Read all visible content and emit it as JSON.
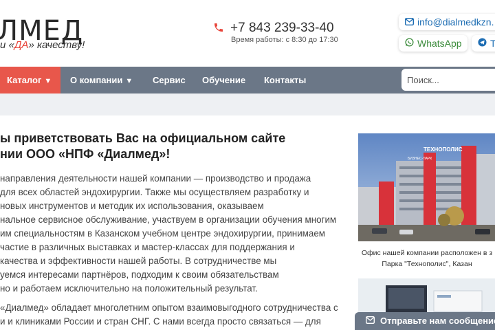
{
  "header": {
    "logo_main": "ЛМЕД",
    "logo_tag_pre": "и «",
    "logo_tag_da": "ДА",
    "logo_tag_post": "» качеству!",
    "phone": "+7 843 239-33-40",
    "work_hours": "Время работы: с 8:30 до 17:30",
    "email": "info@dialmedkzn.",
    "whatsapp": "WhatsApp",
    "telegram": "Т"
  },
  "nav": {
    "catalog": "Каталог",
    "items": [
      "О компании",
      "Сервис",
      "Обучение",
      "Контакты"
    ],
    "search_placeholder": "Поиск..."
  },
  "content": {
    "title_lines": [
      "ы приветствовать Вас на официальном сайте",
      "нии ООО «НПФ «Диалмед»!"
    ],
    "para1_lines": [
      "направления деятельности нашей компании — производство и продажа",
      "для всех областей эндохирургии. Также мы осуществляем разработку и",
      "новых инструментов и методик их использования, оказываем",
      "нальное сервисное обслуживание, участвуем в организации обучения многим",
      "им специальностям в Казанском учебном центре эндохирургии, принимаем",
      "частие в различных выставках и мастер-классах для поддержания и",
      "качества и эффективности нашей работы. В сотрудничестве мы",
      "уемся интересами партнёров, подходим к своим обязательствам",
      "но и работаем исключительно на положительный результат."
    ],
    "para2_lines": [
      "«Диалмед» обладает многолетним опытом взаимовыгодного сотрудничества с",
      "и и клиниками России и стран СНГ. С нами всегда просто связаться — для"
    ]
  },
  "sidebar": {
    "photo_sign_top": "БИЗНЕС-ПАРК",
    "photo_sign_main": "ТЕХНОПОЛИС",
    "caption_lines": [
      "Офис нашей компании расположен в з",
      "Парка \"Технополис\", Казан"
    ]
  },
  "send_message": "Отправьте нам сообщение",
  "colors": {
    "accent_red": "#e8574b",
    "nav_gray": "#6b7787",
    "link_blue": "#1d6db3",
    "whatsapp_green": "#3b8b3b"
  },
  "icons": {
    "phone": "phone-icon",
    "email": "envelope-icon",
    "whatsapp": "whatsapp-icon",
    "telegram": "telegram-icon",
    "message": "envelope-icon"
  }
}
